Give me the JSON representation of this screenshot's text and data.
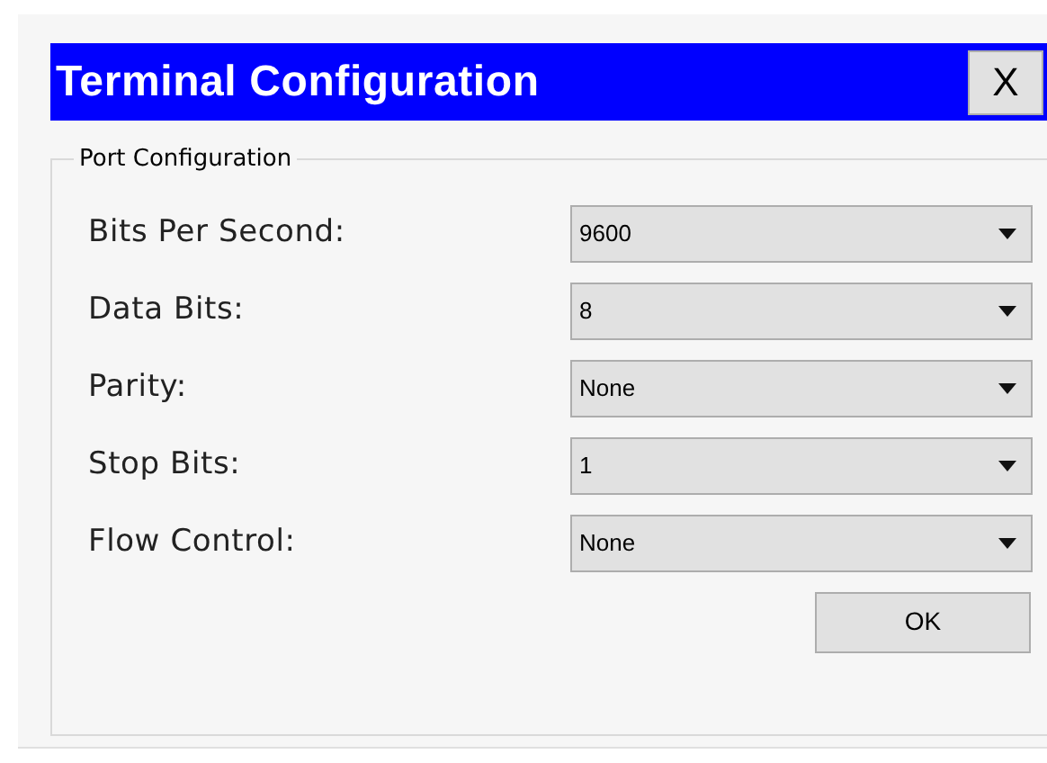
{
  "window": {
    "title": "Terminal Configuration",
    "close_button": "X"
  },
  "group": {
    "title": "Port Configuration",
    "fields": [
      {
        "label": "Bits Per Second:",
        "value": "9600"
      },
      {
        "label": "Data Bits:",
        "value": "8"
      },
      {
        "label": "Parity:",
        "value": "None"
      },
      {
        "label": "Stop Bits:",
        "value": "1"
      },
      {
        "label": "Flow Control:",
        "value": "None"
      }
    ]
  },
  "buttons": [
    "OK"
  ]
}
